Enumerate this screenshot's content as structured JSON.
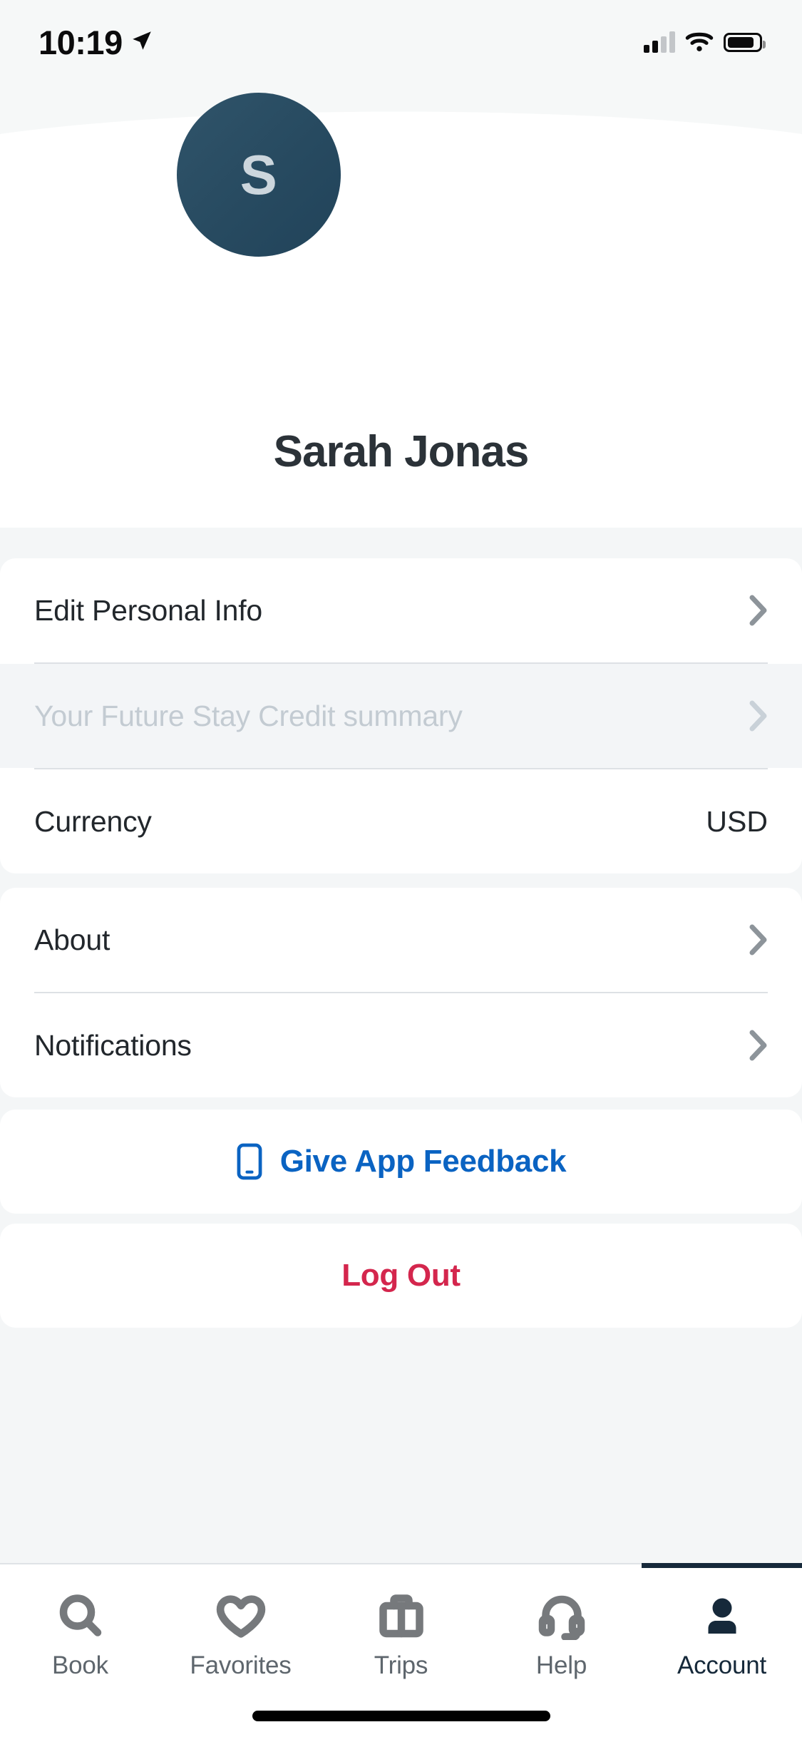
{
  "status_bar": {
    "time": "10:19",
    "location_icon": "location-arrow-icon",
    "signal_icon": "cellular-signal-icon",
    "wifi_icon": "wifi-icon",
    "battery_icon": "battery-icon"
  },
  "profile": {
    "avatar_initial": "S",
    "avatar_icon": "avatar",
    "name": "Sarah Jonas",
    "avatar_color": "#2a4c62",
    "initial_color": "#ccd6dd"
  },
  "account_section": {
    "rows": [
      {
        "label": "Edit Personal Info",
        "value": "",
        "chevron": true,
        "disabled": false
      },
      {
        "label": "Your Future Stay Credit summary",
        "value": "",
        "chevron": true,
        "disabled": true
      },
      {
        "label": "Currency",
        "value": "USD",
        "chevron": false,
        "disabled": false
      }
    ]
  },
  "info_section": {
    "rows": [
      {
        "label": "About",
        "value": "",
        "chevron": true,
        "disabled": false
      },
      {
        "label": "Notifications",
        "value": "",
        "chevron": true,
        "disabled": false
      }
    ]
  },
  "feedback": {
    "label": "Give App Feedback",
    "icon": "mobile-phone-icon",
    "color": "#0a63c2"
  },
  "logout": {
    "label": "Log Out",
    "color": "#d4264d"
  },
  "tabbar": {
    "active_color": "#16293a",
    "inactive_color": "#5e666d",
    "tabs": [
      {
        "label": "Book",
        "icon": "search-icon",
        "active": false
      },
      {
        "label": "Favorites",
        "icon": "heart-icon",
        "active": false
      },
      {
        "label": "Trips",
        "icon": "briefcase-icon",
        "active": false
      },
      {
        "label": "Help",
        "icon": "headset-icon",
        "active": false
      },
      {
        "label": "Account",
        "icon": "person-icon",
        "active": true
      }
    ]
  }
}
